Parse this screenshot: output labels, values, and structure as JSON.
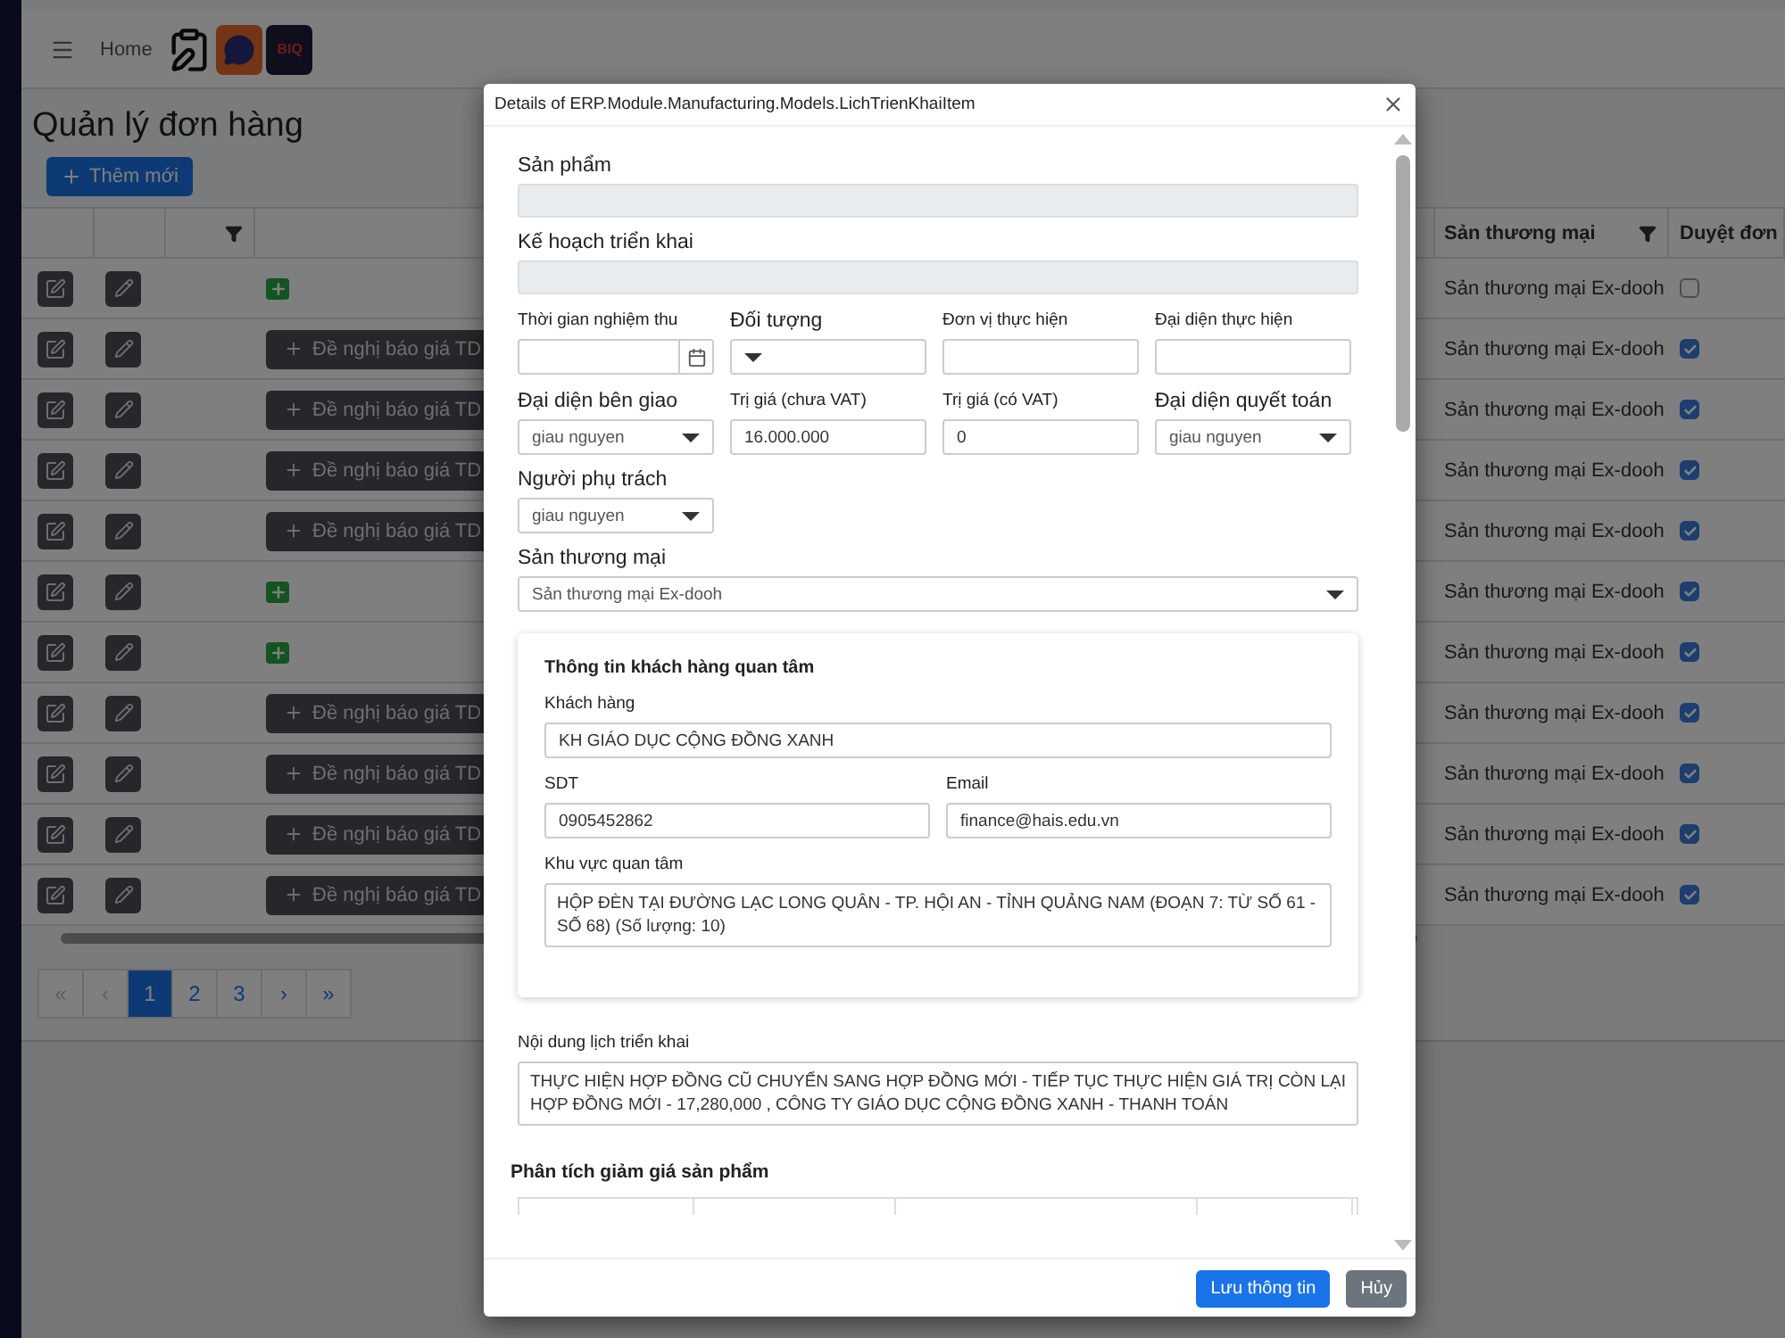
{
  "header": {
    "home": "Home",
    "logo_text": "BIQ"
  },
  "page": {
    "title": "Quản lý đơn hàng",
    "add_button": "Thêm mới"
  },
  "table": {
    "columns": [
      {
        "label": "Sản thương mại"
      },
      {
        "label": "Duyệt đơn"
      }
    ],
    "rows": [
      {
        "kind": "add",
        "market": "Sản thương mại Ex-dooh",
        "approved": false
      },
      {
        "kind": "request",
        "action": "Đề nghị báo giá TD",
        "market": "Sản thương mại Ex-dooh",
        "approved": true
      },
      {
        "kind": "request",
        "action": "Đề nghị báo giá TD",
        "market": "Sản thương mại Ex-dooh",
        "approved": true
      },
      {
        "kind": "request",
        "action": "Đề nghị báo giá TD",
        "market": "Sản thương mại Ex-dooh",
        "approved": true
      },
      {
        "kind": "request",
        "action": "Đề nghị báo giá TD",
        "market": "Sản thương mại Ex-dooh",
        "approved": true
      },
      {
        "kind": "add",
        "market": "Sản thương mại Ex-dooh",
        "approved": true
      },
      {
        "kind": "add",
        "market": "Sản thương mại Ex-dooh",
        "approved": true
      },
      {
        "kind": "request",
        "action": "Đề nghị báo giá TD",
        "market": "Sản thương mại Ex-dooh",
        "approved": true
      },
      {
        "kind": "request",
        "action": "Đề nghị báo giá TD",
        "market": "Sản thương mại Ex-dooh",
        "approved": true
      },
      {
        "kind": "request",
        "action": "Đề nghị báo giá TD",
        "market": "Sản thương mại Ex-dooh",
        "approved": true
      },
      {
        "kind": "request",
        "action": "Đề nghị báo giá TD",
        "market": "Sản thương mại Ex-dooh",
        "approved": true
      }
    ]
  },
  "pagination": [
    {
      "label": "«",
      "selected": false,
      "disabled": true
    },
    {
      "label": "‹",
      "selected": false,
      "disabled": true
    },
    {
      "label": "1",
      "selected": true,
      "disabled": false
    },
    {
      "label": "2",
      "selected": false,
      "disabled": false
    },
    {
      "label": "3",
      "selected": false,
      "disabled": false
    },
    {
      "label": "›",
      "selected": false,
      "disabled": false
    },
    {
      "label": "»",
      "selected": false,
      "disabled": false
    }
  ],
  "dialog": {
    "title": "Details of ERP.Module.Manufacturing.Models.LichTrienKhaiItem",
    "sections": [
      {
        "label": "Sản phẩm",
        "kind": "readonly"
      },
      {
        "label": "Kế hoạch triển khai",
        "kind": "readonly"
      }
    ],
    "grid": [
      {
        "label": "Thời gian nghiệm thu",
        "emphasized": false,
        "kind": "date"
      },
      {
        "label": "Đối tượng",
        "emphasized": true,
        "kind": "select"
      },
      {
        "label": "Đơn vị thực hiện",
        "emphasized": false,
        "kind": "text"
      },
      {
        "label": "Đại diện thực hiện",
        "emphasized": false,
        "kind": "text"
      },
      {
        "label": "Đại diện bên giao",
        "emphasized": true,
        "kind": "select",
        "value": "giau nguyen"
      },
      {
        "label": "Trị giá (chưa VAT)",
        "emphasized": false,
        "kind": "text",
        "value": "16.000.000"
      },
      {
        "label": "Trị giá (có VAT)",
        "emphasized": false,
        "kind": "text",
        "value": "0"
      },
      {
        "label": "Đại diện quyết toán",
        "emphasized": true,
        "kind": "select",
        "value": "giau nguyen"
      },
      {
        "label": "Người phụ trách",
        "emphasized": true,
        "kind": "select",
        "value": "giau nguyen"
      }
    ],
    "market": {
      "label": "Sản thương mại",
      "value": "Sản thương mại Ex-dooh"
    },
    "customer": {
      "title": "Thông tin khách hàng quan tâm",
      "customer_label": "Khách hàng",
      "customer": "KH GIÁO DỤC CỘNG ĐỒNG XANH",
      "phone_label": "SDT",
      "phone": "0905452862",
      "email_label": "Email",
      "email": "finance@hais.edu.vn",
      "area_label": "Khu vực quan tâm",
      "area": "HỘP ĐÈN TẠI ĐƯỜNG LẠC LONG QUÂN - TP. HỘI AN - TỈNH QUẢNG NAM (ĐOẠN 7: TỪ SỐ 61 - SỐ 68) (Số lượng: 10)"
    },
    "content_label": "Nội dung lịch triển khai",
    "content": "THỰC HIỆN HỢP ĐỒNG CŨ CHUYỂN SANG HỢP ĐỒNG MỚI - TIẾP TỤC THỰC HIỆN GIÁ TRỊ CÒN LẠI HỢP ĐỒNG MỚI - 17,280,000 , CÔNG TY GIÁO DỤC CỘNG ĐỒNG XANH - THANH TOÁN",
    "discount_title": "Phân tích giảm giá sản phẩm",
    "buttons": [
      {
        "kind": "primary",
        "label": "Lưu thông tin"
      },
      {
        "kind": "secondary",
        "label": "Hủy"
      }
    ]
  }
}
